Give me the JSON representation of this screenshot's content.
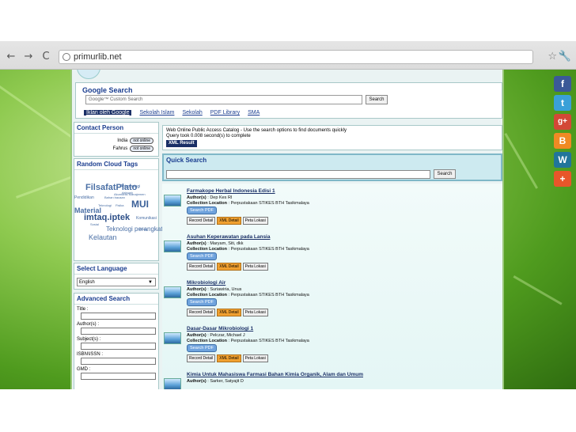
{
  "browser": {
    "url": "primurlib.net",
    "back": "←",
    "forward": "→",
    "reload": "C",
    "star": "☆",
    "wrench": "🔧"
  },
  "google": {
    "title": "Google Search",
    "placeholder": "Google™ Custom Search",
    "button": "Search",
    "links": [
      "Iklan oleh Google",
      "Sekolah Islam",
      "Sekolah",
      "PDF Library",
      "SMA"
    ]
  },
  "contact": {
    "title": "Contact Person",
    "people": [
      {
        "name": "India",
        "status": "not online"
      },
      {
        "name": "Fahrus",
        "status": "not online"
      }
    ]
  },
  "cloud": {
    "title": "Random Cloud Tags",
    "tags": [
      "FilsafatPlato",
      "Antropologi",
      "Akuntansi Manajemen",
      "MUI",
      "Pendidikan",
      "Bahan bacaan",
      "Material",
      "Teknologi",
      "imtaq.iptek",
      "Komunikasi",
      "Teknologi perangkat",
      "Kelautan",
      "dakwah",
      "Fisika",
      "Sosial",
      "Kimia"
    ]
  },
  "language": {
    "title": "Select Language",
    "selected": "English",
    "caret": "▼"
  },
  "advanced": {
    "title": "Advanced Search",
    "fields": [
      "Title :",
      "Author(s) :",
      "Subject(s) :",
      "ISBN\\ISSN :",
      "GMD :"
    ]
  },
  "info": {
    "line1": "Web Online Public Access Catalog - Use the search options to find documents quickly",
    "line2": "Query took 0.008 second(s) to complete",
    "xml": "XML Result"
  },
  "quick": {
    "title": "Quick Search",
    "button": "Search"
  },
  "labels": {
    "author": "Author(s)",
    "location": "Collection Location",
    "pdf": "Search PDF",
    "record": "Record Detail",
    "xml": "XML Detail",
    "peta": "Peta Lokasi"
  },
  "records": [
    {
      "title": "Farmakope Herbal Indonesia Edisi 1",
      "author": ": Dep Kes RI",
      "location": ": Perpustakaan STIKES BTH Tasikmalaya"
    },
    {
      "title": "Asuhan Keperawatan pada Lansia",
      "author": ": Maryam, Siti, dkk",
      "location": ": Perpustakaan STIKES BTH Tasikmalaya"
    },
    {
      "title": "Mikrobiologi Air",
      "author": ": Suriawiria, Unus",
      "location": ": Perpustakaan STIKES BTH Tasikmalaya"
    },
    {
      "title": "Dasar-Dasar Mikrobiologi 1",
      "author": ": Pelczar, Michael J",
      "location": ": Perpustakaan STIKES BTH Tasikmalaya"
    },
    {
      "title": "Kimia Untuk Mahasiswa Farmasi Bahan Kimia Organik, Alam dan Umum",
      "author": ": Sarker, Satyajit D",
      "location": ""
    }
  ],
  "social": [
    {
      "glyph": "f",
      "color": "#3b5998",
      "name": "facebook"
    },
    {
      "glyph": "t",
      "color": "#3aa0d8",
      "name": "twitter"
    },
    {
      "glyph": "g+",
      "color": "#d34836",
      "name": "google-plus"
    },
    {
      "glyph": "B",
      "color": "#f08a24",
      "name": "blogger"
    },
    {
      "glyph": "W",
      "color": "#21759b",
      "name": "wordpress"
    },
    {
      "glyph": "+",
      "color": "#e8562a",
      "name": "more"
    }
  ]
}
